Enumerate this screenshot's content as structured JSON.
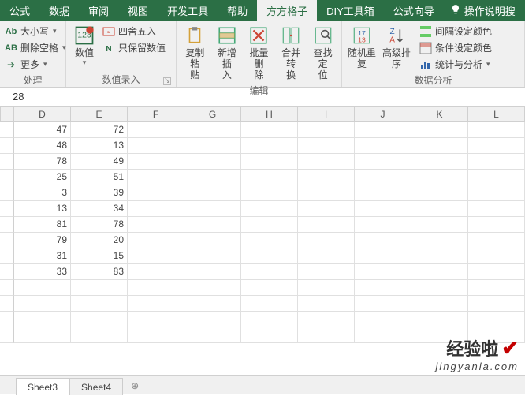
{
  "tabs": {
    "items": [
      "公式",
      "数据",
      "审阅",
      "视图",
      "开发工具",
      "帮助",
      "方方格子",
      "DIY工具箱",
      "公式向导"
    ],
    "active_index": 6,
    "tell_me": "操作说明搜"
  },
  "ribbon": {
    "group_process": {
      "case_label": "大小写",
      "trim_label": "删除空格",
      "more_label": "更多",
      "label": "处理"
    },
    "group_numeric": {
      "numeric_btn": "数值",
      "round_label": "四舍五入",
      "keep_num_label": "只保留数值",
      "label": "数值录入"
    },
    "group_edit": {
      "copy_paste": "复制粘\n贴",
      "insert_new": "新增插\n入",
      "batch_del": "批量删\n除",
      "merge_conv": "合并转\n换",
      "find_loc": "查找定\n位",
      "label": "编辑"
    },
    "group_analysis": {
      "random_rep": "随机重\n复",
      "adv_sort": "高级排\n序",
      "interval_color": "间隔设定颜色",
      "cond_color": "条件设定颜色",
      "stats": "统计与分析",
      "label": "数据分析"
    }
  },
  "formula_bar": {
    "value": "28"
  },
  "columns": [
    "",
    "D",
    "E",
    "F",
    "G",
    "H",
    "I",
    "J",
    "K",
    "L"
  ],
  "rows": [
    {
      "D": "47",
      "E": "72"
    },
    {
      "D": "48",
      "E": "13"
    },
    {
      "D": "78",
      "E": "49"
    },
    {
      "D": "25",
      "E": "51"
    },
    {
      "D": "3",
      "E": "39"
    },
    {
      "D": "13",
      "E": "34"
    },
    {
      "D": "81",
      "E": "78"
    },
    {
      "D": "79",
      "E": "20"
    },
    {
      "D": "31",
      "E": "15"
    },
    {
      "D": "33",
      "E": "83"
    },
    {
      "D": "",
      "E": ""
    },
    {
      "D": "",
      "E": ""
    },
    {
      "D": "",
      "E": ""
    },
    {
      "D": "",
      "E": ""
    }
  ],
  "sheets": {
    "items": [
      "Sheet3",
      "Sheet4"
    ],
    "active_index": 0
  },
  "watermark": {
    "line1": "经验啦",
    "line2": "jingyanla.com"
  }
}
